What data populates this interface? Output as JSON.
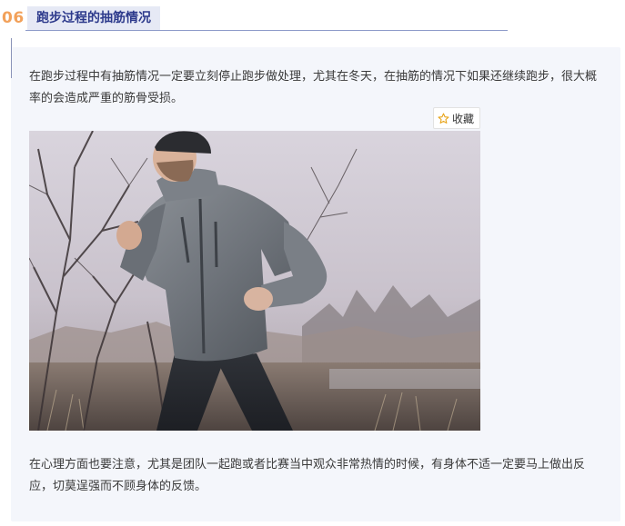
{
  "section": {
    "number": "06",
    "title": "跑步过程的抽筋情况"
  },
  "paragraphs": {
    "first": "在跑步过程中有抽筋情况一定要立刻停止跑步做处理，尤其在冬天，在抽筋的情况下如果还继续跑步，很大概率的会造成严重的筋骨受损。",
    "second": "在心理方面也要注意，尤其是团队一起跑或者比赛当中观众非常热情的时候，有身体不适一定要马上做出反应，切莫逞强而不顾身体的反馈。"
  },
  "favorite_button": {
    "label": "收藏",
    "icon": "star-outline-icon"
  },
  "photo": {
    "subject": "runner-photo"
  },
  "colors": {
    "section_number": "#f2a15a",
    "section_title_text": "#2d3a8c",
    "section_title_bg": "#e6e9f5",
    "card_bg": "#f4f6fb",
    "body_text": "#3a3a3a",
    "star": "#e8a317"
  }
}
